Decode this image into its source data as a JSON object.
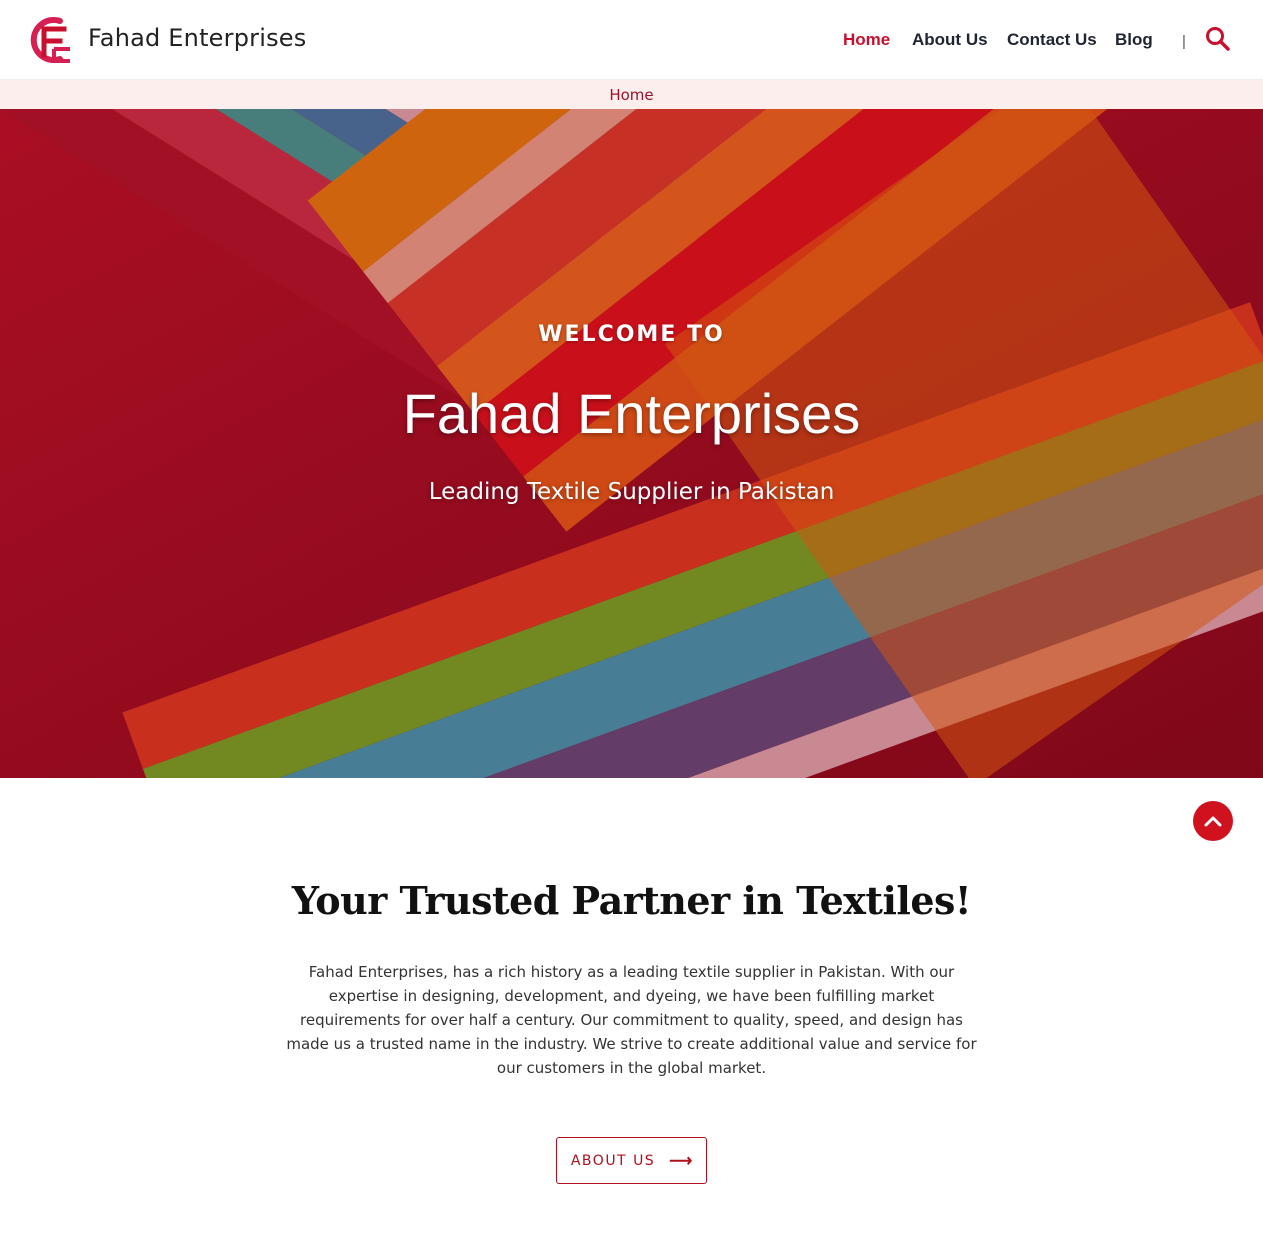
{
  "header": {
    "brand": "Fahad Enterprises",
    "nav": [
      {
        "label": "Home",
        "active": true
      },
      {
        "label": "About Us",
        "active": false
      },
      {
        "label": "Contact Us",
        "active": false
      },
      {
        "label": "Blog",
        "active": false
      }
    ],
    "separator": "|",
    "search_icon": "search-icon"
  },
  "breadcrumb": {
    "current": "Home"
  },
  "hero": {
    "welcome": "WELCOME  TO",
    "title": "Fahad Enterprises",
    "subtitle": "Leading Textile Supplier in Pakistan"
  },
  "about": {
    "title": "Your Trusted Partner in Textiles!",
    "text": "Fahad Enterprises, has a rich history as a leading textile supplier in Pakistan. With our expertise in designing, development, and dyeing, we have been fulfilling market requirements for over half a century. Our commitment to quality, speed, and design has made us a trusted name in the industry. We strive to create additional value and service for our customers in the global market.",
    "button_label": "ABOUT US",
    "button_icon": "arrow-right-icon"
  },
  "scroll_top_icon": "chevron-up-icon",
  "colors": {
    "accent": "#c8102e",
    "breadcrumb_bg": "#fdeeee",
    "nav_text": "#1f2433"
  }
}
